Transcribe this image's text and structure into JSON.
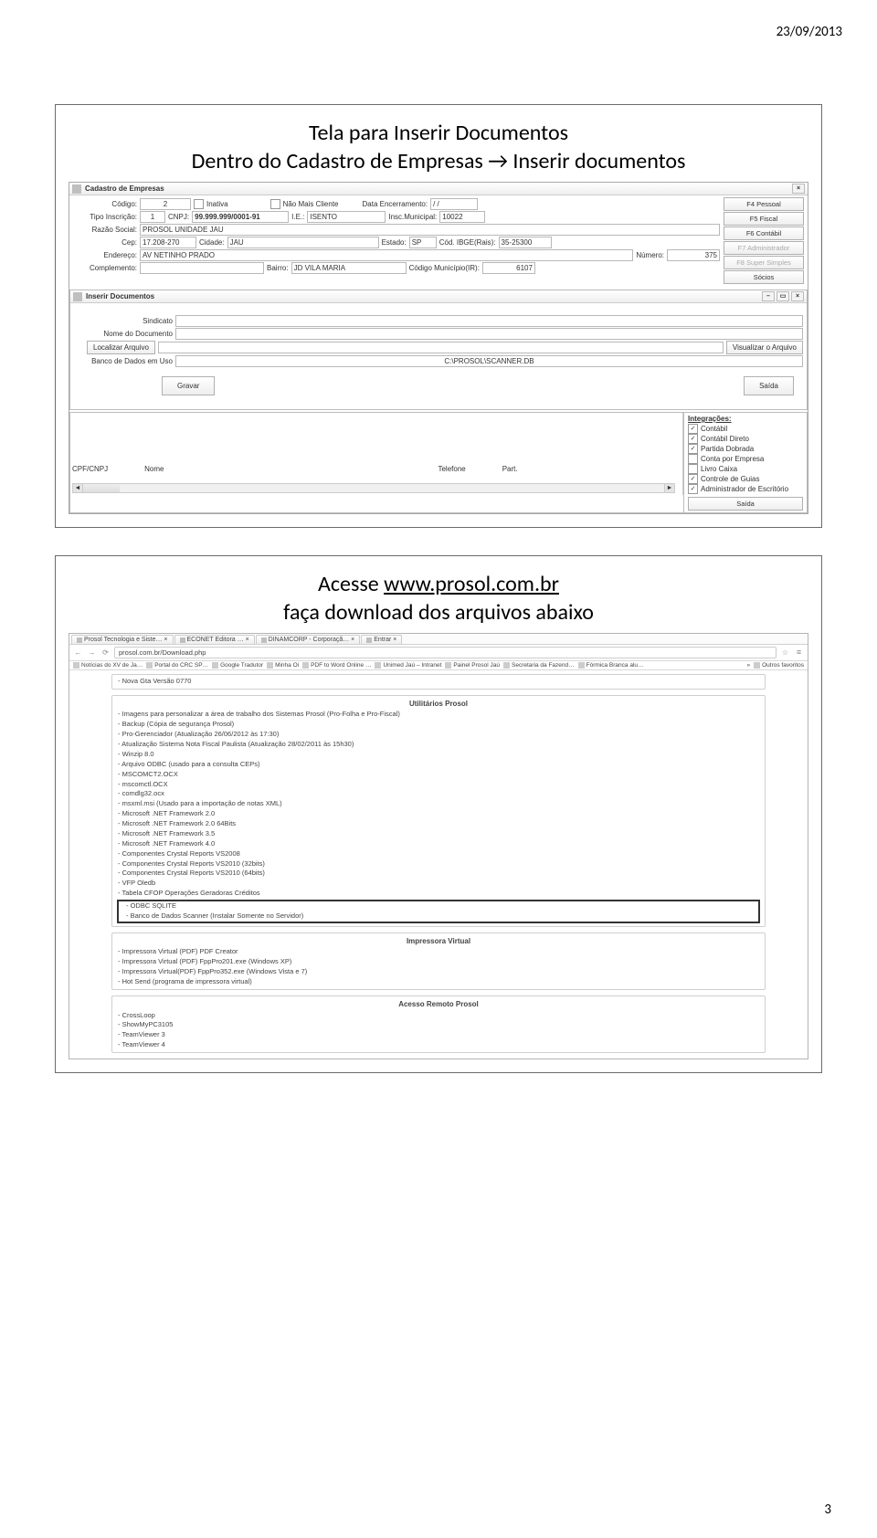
{
  "date": "23/09/2013",
  "page_number": "3",
  "slide1": {
    "title_line1": "Tela para Inserir Documentos",
    "title_line2": "Dentro do Cadastro de Empresas → Inserir documentos",
    "win1_title": "Cadastro de Empresas",
    "win2_title": "Inserir Documentos",
    "labels": {
      "codigo": "Código:",
      "inativa": "Inativa",
      "nao_mais_cliente": "Não Mais Cliente",
      "data_enc": "Data Encerramento:",
      "tipo_inscr": "Tipo Inscrição:",
      "cnpj": "CNPJ:",
      "ie": "I.E.:",
      "insc_mun": "Insc.Municipal:",
      "razao": "Razão Social:",
      "cep": "Cep:",
      "cidade": "Cidade:",
      "estado": "Estado:",
      "cod_ibge": "Cód. IBGE(Rais):",
      "endereco": "Endereço:",
      "numero": "Número:",
      "complemento": "Complemento:",
      "bairro": "Bairro:",
      "cod_mun_ir": "Código Município(IR):",
      "sindicato": "Sindicato",
      "nome_doc": "Nome do Documento",
      "banco_uso": "Banco de Dados em Uso"
    },
    "values": {
      "codigo": "2",
      "data_enc": "/  /",
      "tipo_inscr": "1",
      "cnpj": "99.999.999/0001-91",
      "ie": "ISENTO",
      "insc_mun": "10022",
      "razao": "PROSOL UNIDADE JAU",
      "cep": "17.208-270",
      "cidade": "JAU",
      "estado": "SP",
      "cod_ibge": "35-25300",
      "endereco": "AV NETINHO PRADO",
      "numero": "375",
      "bairro": "JD VILA MARIA",
      "cod_mun_ir": "6107",
      "banco_uso": "C:\\PROSOL\\SCANNER.DB"
    },
    "side_buttons": [
      "F4 Pessoal",
      "F5 Fiscal",
      "F6 Contábil",
      "F7 Administrador",
      "F8 Super Simples",
      "Sócios"
    ],
    "btn_localizar": "Localizar Arquivo",
    "btn_visualizar": "Visualizar o Arquivo",
    "btn_gravar": "Gravar",
    "btn_saida": "Saída",
    "grid_cols": {
      "cpf": "CPF/CNPJ",
      "nome": "Nome",
      "telefone": "Telefone",
      "part": "Part."
    },
    "integr": {
      "title": "Integrações:",
      "items": [
        {
          "label": "Contábil",
          "checked": true
        },
        {
          "label": "Contábil Direto",
          "checked": true
        },
        {
          "label": "Partida Dobrada",
          "checked": true
        },
        {
          "label": "Conta por Empresa",
          "checked": false
        },
        {
          "label": "Livro Caixa",
          "checked": false
        },
        {
          "label": "Controle de Guias",
          "checked": true
        },
        {
          "label": "Administrador de Escritório",
          "checked": true
        }
      ],
      "saida": "Saída"
    }
  },
  "slide2": {
    "title_line1_pre": "Acesse ",
    "title_link": "www.prosol.com.br",
    "title_line2": "faça download dos arquivos abaixo",
    "tabs": [
      "Prosol Tecnologia e Siste… ×",
      "ECONET Editora … ×",
      "DINAMCORP - Corporaçã… ×",
      "Entrar ×"
    ],
    "url": "prosol.com.br/Download.php",
    "bookmarks": [
      "Notícias do XV de Ja…",
      "Portal do CRC SP…",
      "Google Tradutor",
      "Minha Oi",
      "PDF to Word Online …",
      "Unimed Jaú – Intranet",
      "Painel Prosol Jaú",
      "Secretaria da Fazend…",
      "Fórmica Branca alu…",
      "»",
      "Outros favoritos"
    ],
    "top_line": "- Nova Gta Versão 0770",
    "util_title": "Utilitários Prosol",
    "util_items": [
      "- Imagens para personalizar a área de trabalho dos Sistemas Prosol (Pro-Folha e Pro-Fiscal)",
      "- Backup (Cópia de segurança Prosol)",
      "- Pro-Gerenciador (Atualização 26/06/2012 às 17:30)",
      "- Atualização Sistema Nota Fiscal Paulista (Atualização 28/02/2011 às 15h30)",
      "- Winzip 8.0",
      "- Arquivo ODBC (usado para a consulta CEPs)",
      "- MSCOMCT2.OCX",
      "- mscomctl.OCX",
      "- comdlg32.ocx",
      "- msxml.msi (Usado para a importação de notas XML)",
      "- Microsoft .NET Framework 2.0",
      "- Microsoft .NET Framework 2.0 64Bits",
      "- Microsoft .NET Framework 3.5",
      "- Microsoft .NET Framework 4.0",
      "- Componentes Crystal Reports VS2008",
      "- Componentes Crystal Reports VS2010 (32bits)",
      "- Componentes Crystal Reports VS2010 (64bits)",
      "- VFP Oledb",
      "- Tabela CFOP Operações Geradoras Créditos"
    ],
    "hl_items": [
      "- ODBC SQLITE",
      "- Banco de Dados Scanner (Instalar Somente no Servidor)"
    ],
    "impr_title": "Impressora Virtual",
    "impr_items": [
      "- Impressora Virtual (PDF) PDF Creator",
      "- Impressora Virtual (PDF) FppPro201.exe (Windows XP)",
      "- Impressora Virtual(PDF) FppPro352.exe (Windows Vista e 7)",
      "- Hot Send (programa de impressora virtual)"
    ],
    "rem_title": "Acesso Remoto Prosol",
    "rem_items": [
      "- CrossLoop",
      "- ShowMyPC3105",
      "- TeamViewer 3",
      "- TeamViewer 4"
    ]
  }
}
